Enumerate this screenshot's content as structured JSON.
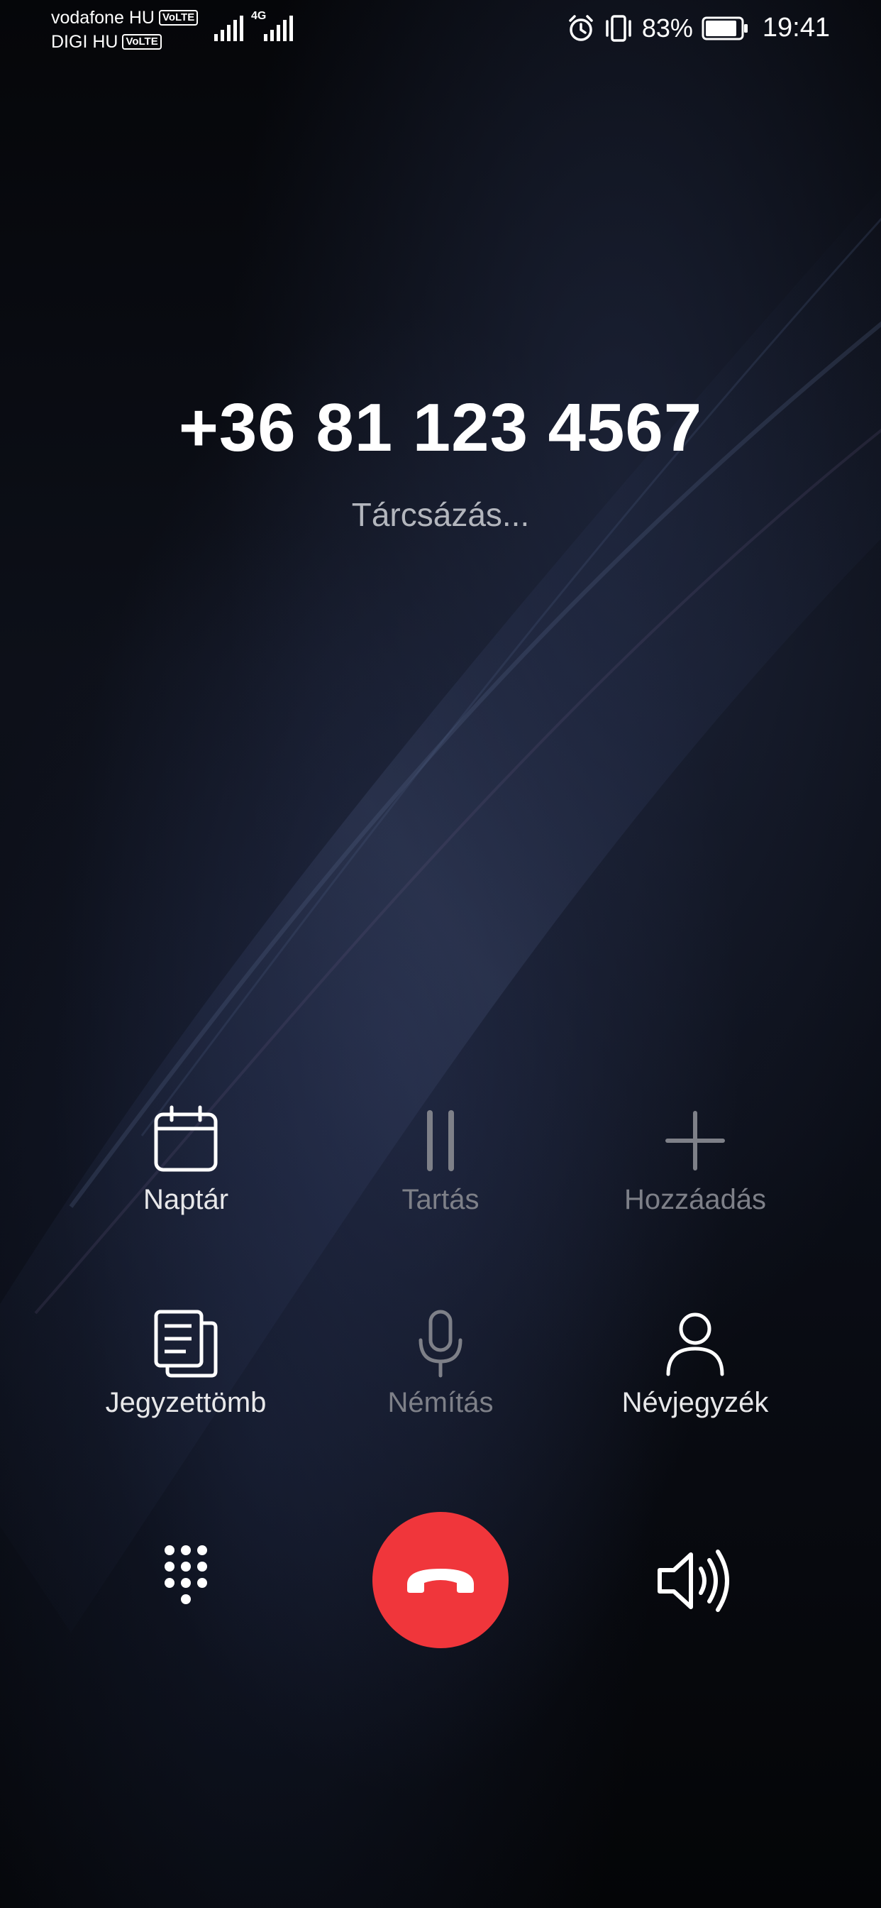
{
  "status_bar": {
    "carrier1": "vodafone HU",
    "carrier2": "DIGI HU",
    "volte": "VoLTE",
    "network_type": "4G",
    "battery_percent": "83%",
    "time": "19:41"
  },
  "call": {
    "number": "+36 81 123 4567",
    "status": "Tárcsázás..."
  },
  "controls": {
    "calendar": "Naptár",
    "hold": "Tartás",
    "add": "Hozzáadás",
    "notepad": "Jegyzettömb",
    "mute": "Némítás",
    "contacts": "Névjegyzék"
  },
  "colors": {
    "end_call": "#f0363b",
    "disabled": "#7e8088"
  }
}
